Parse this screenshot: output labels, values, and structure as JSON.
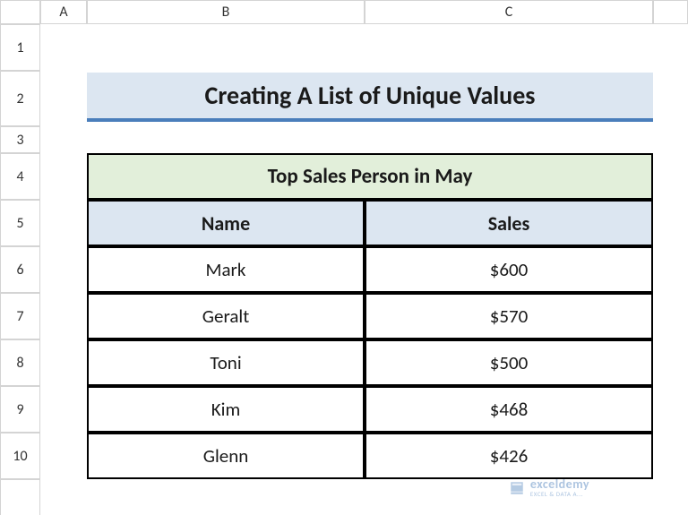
{
  "columns": [
    "A",
    "B",
    "C"
  ],
  "rows": [
    "1",
    "2",
    "3",
    "4",
    "5",
    "6",
    "7",
    "8",
    "9",
    "10"
  ],
  "title": "Creating A List of Unique Values",
  "table": {
    "header": "Top Sales Person in May",
    "columns": [
      "Name",
      "Sales"
    ],
    "rows": [
      {
        "name": "Mark",
        "sales": "$600"
      },
      {
        "name": "Geralt",
        "sales": "$570"
      },
      {
        "name": "Toni",
        "sales": "$500"
      },
      {
        "name": "Kim",
        "sales": "$468"
      },
      {
        "name": "Glenn",
        "sales": "$426"
      }
    ]
  },
  "watermark": {
    "main": "exceldemy",
    "sub": "EXCEL & DATA A..."
  }
}
